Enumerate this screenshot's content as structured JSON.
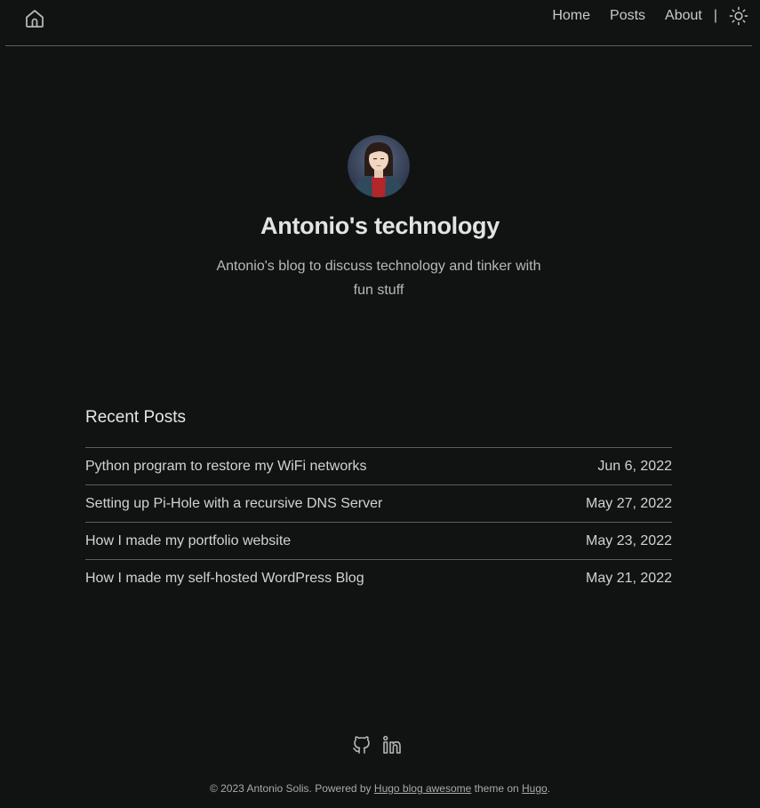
{
  "header": {
    "home_icon": "home-icon",
    "nav": {
      "home": "Home",
      "posts": "Posts",
      "about": "About",
      "separator": "|"
    },
    "theme_icon": "sun-icon"
  },
  "hero": {
    "title": "Antonio's technology",
    "tagline": "Antonio's blog to discuss technology and tinker with fun stuff"
  },
  "recent": {
    "heading": "Recent Posts",
    "posts": [
      {
        "title": "Python program to restore my WiFi networks",
        "date": "Jun 6, 2022"
      },
      {
        "title": "Setting up Pi-Hole with a recursive DNS Server",
        "date": "May 27, 2022"
      },
      {
        "title": "How I made my portfolio website",
        "date": "May 23, 2022"
      },
      {
        "title": "How I made my self-hosted WordPress Blog",
        "date": "May 21, 2022"
      }
    ]
  },
  "footer": {
    "social_icons": [
      "github-icon",
      "linkedin-icon"
    ],
    "copyright": "© 2023 Antonio Solis. Powered by ",
    "theme_link": "Hugo blog awesome",
    "middle": " theme on ",
    "hugo_link": "Hugo",
    "end": "."
  },
  "colors": {
    "background": "#111313",
    "divider": "#5d5f5c",
    "text": "#d2d2d2"
  }
}
